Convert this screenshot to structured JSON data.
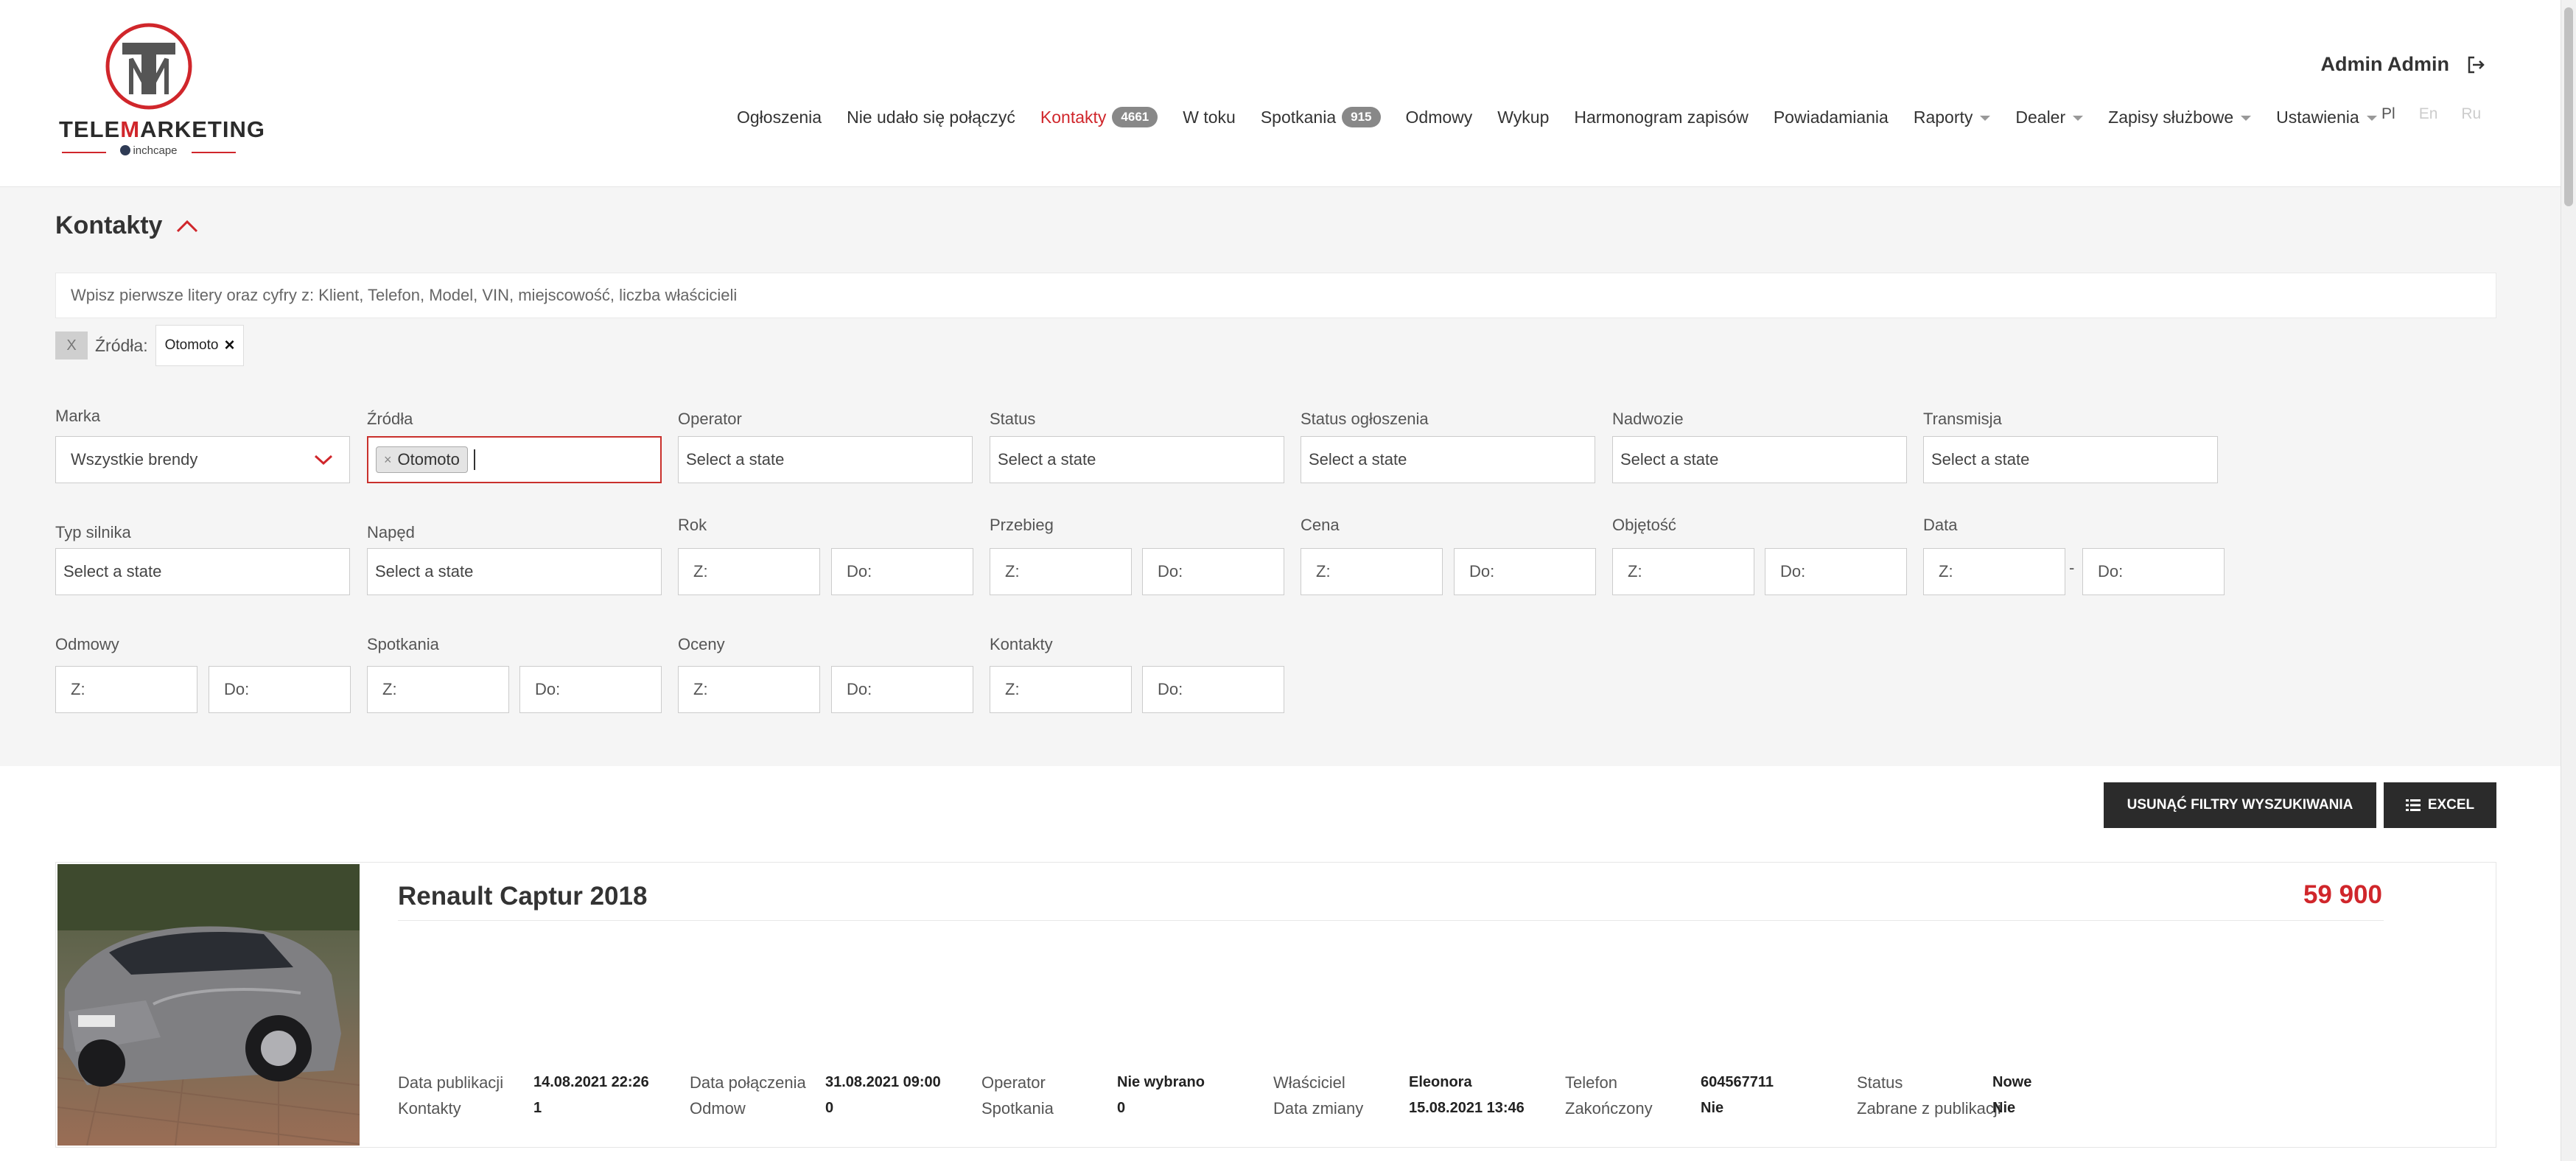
{
  "brand": {
    "name_part1": "TELE",
    "name_part2": "M",
    "name_part3": "ARKETING",
    "sub": "inchcape",
    "accent": "#d0262b"
  },
  "user": {
    "name": "Admin Admin",
    "logout_icon": "logout-icon"
  },
  "nav": {
    "items": [
      {
        "label": "Ogłoszenia"
      },
      {
        "label": "Nie udało się połączyć"
      },
      {
        "label": "Kontakty",
        "badge": "4661",
        "active": true
      },
      {
        "label": "W toku"
      },
      {
        "label": "Spotkania",
        "badge": "915"
      },
      {
        "label": "Odmowy"
      },
      {
        "label": "Wykup"
      },
      {
        "label": "Harmonogram zapisów"
      },
      {
        "label": "Powiadamiania"
      },
      {
        "label": "Raporty",
        "dropdown": true
      },
      {
        "label": "Dealer",
        "dropdown": true
      },
      {
        "label": "Zapisy służbowe",
        "dropdown": true
      },
      {
        "label": "Ustawienia",
        "dropdown": true
      }
    ],
    "langs": [
      "Pl",
      "En",
      "Ru"
    ]
  },
  "page": {
    "title": "Kontakty"
  },
  "search": {
    "placeholder": "Wpisz pierwsze litery oraz cyfry z: Klient, Telefon, Model, VIN, miejscowość, liczba właścicieli"
  },
  "active_filters": {
    "clear": "X",
    "label": "Źródła:",
    "chip": "Otomoto"
  },
  "filters": {
    "marka": {
      "label": "Marka",
      "value": "Wszystkie brendy"
    },
    "zrodla": {
      "label": "Źródła",
      "tag": "Otomoto"
    },
    "operator": {
      "label": "Operator",
      "placeholder": "Select a state"
    },
    "status": {
      "label": "Status",
      "placeholder": "Select a state"
    },
    "status_ogloszenia": {
      "label": "Status ogłoszenia",
      "placeholder": "Select a state"
    },
    "nadwozie": {
      "label": "Nadwozie",
      "placeholder": "Select a state"
    },
    "transmisja": {
      "label": "Transmisja",
      "placeholder": "Select a state"
    },
    "typ_silnika": {
      "label": "Typ silnika",
      "placeholder": "Select a state"
    },
    "naped": {
      "label": "Napęd",
      "placeholder": "Select a state"
    },
    "rok": {
      "label": "Rok"
    },
    "przebieg": {
      "label": "Przebieg"
    },
    "cena": {
      "label": "Cena"
    },
    "objetosc": {
      "label": "Objętość"
    },
    "data": {
      "label": "Data",
      "dash": "-"
    },
    "odmowy": {
      "label": "Odmowy"
    },
    "spotkania": {
      "label": "Spotkania"
    },
    "oceny": {
      "label": "Oceny"
    },
    "kontakty": {
      "label": "Kontakty"
    },
    "from_placeholder": "Z:",
    "to_placeholder": "Do:"
  },
  "actions": {
    "clear_filters": "USUNĄĆ FILTRY WYSZUKIWANIA",
    "excel": "EXCEL"
  },
  "listing": {
    "title": "Renault Captur 2018",
    "price": "59 900",
    "fields": [
      {
        "k": "Data publikacji",
        "v": "14.08.2021 22:26"
      },
      {
        "k": "Kontakty",
        "v": "1"
      },
      {
        "k": "Data połączenia",
        "v": "31.08.2021 09:00"
      },
      {
        "k": "Odmow",
        "v": "0"
      },
      {
        "k": "Operator",
        "v": "Nie wybrano"
      },
      {
        "k": "Spotkania",
        "v": "0"
      },
      {
        "k": "Właściciel",
        "v": "Eleonora"
      },
      {
        "k": "Data zmiany",
        "v": "15.08.2021 13:46"
      },
      {
        "k": "Telefon",
        "v": "604567711"
      },
      {
        "k": "Zakończony",
        "v": "Nie"
      },
      {
        "k": "Status",
        "v": "Nowe"
      },
      {
        "k": "Zabrane z publikacji",
        "v": "Nie"
      }
    ]
  }
}
